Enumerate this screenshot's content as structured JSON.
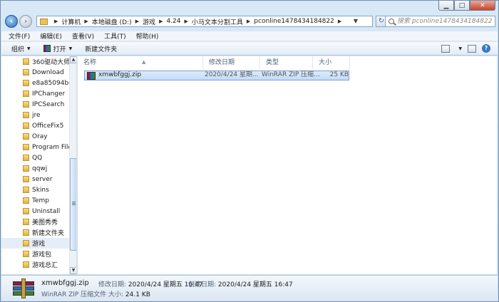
{
  "window": {
    "minimize": "▁",
    "maximize": "□",
    "close": "✕"
  },
  "address": {
    "crumbs": [
      "计算机",
      "本地磁盘 (D:)",
      "游戏",
      "4.24",
      "小马文本分割工具",
      "pconline1478434184822"
    ],
    "search_placeholder": "搜索 pconline1478434184822"
  },
  "menu": [
    "文件(F)",
    "编辑(E)",
    "查看(V)",
    "工具(T)",
    "帮助(H)"
  ],
  "toolbar": {
    "organize": "组织",
    "open": "打开",
    "new_folder": "新建文件夹"
  },
  "nav": {
    "items": [
      {
        "label": "360驱动大师目"
      },
      {
        "label": "Download"
      },
      {
        "label": "e8a85094bdb"
      },
      {
        "label": "IPChanger"
      },
      {
        "label": "IPCSearch"
      },
      {
        "label": "jre"
      },
      {
        "label": "OfficeFix5"
      },
      {
        "label": "Oray"
      },
      {
        "label": "Program Files"
      },
      {
        "label": "QQ"
      },
      {
        "label": "qqwj"
      },
      {
        "label": "server"
      },
      {
        "label": "Skins"
      },
      {
        "label": "Temp"
      },
      {
        "label": "Uninstall"
      },
      {
        "label": "美图秀秀"
      },
      {
        "label": "新建文件夹"
      },
      {
        "label": "游戏",
        "selected": true
      },
      {
        "label": "游戏包"
      },
      {
        "label": "游戏总汇"
      }
    ]
  },
  "columns": {
    "name": "名称",
    "date": "修改日期",
    "type": "类型",
    "size": "大小"
  },
  "files": [
    {
      "name": "xmwbfggj.zip",
      "date": "2020/4/24 星期...",
      "type": "WinRAR ZIP 压缩...",
      "size": "25 KB"
    }
  ],
  "details": {
    "name": "xmwbfggj.zip",
    "type": "WinRAR ZIP 压缩文件",
    "modified_label": "修改日期:",
    "modified": "2020/4/24 星期五 16:47",
    "created_label": "创建日期:",
    "created": "2020/4/24 星期五 16:47",
    "size_label": "大小:",
    "size": "24.1 KB"
  }
}
